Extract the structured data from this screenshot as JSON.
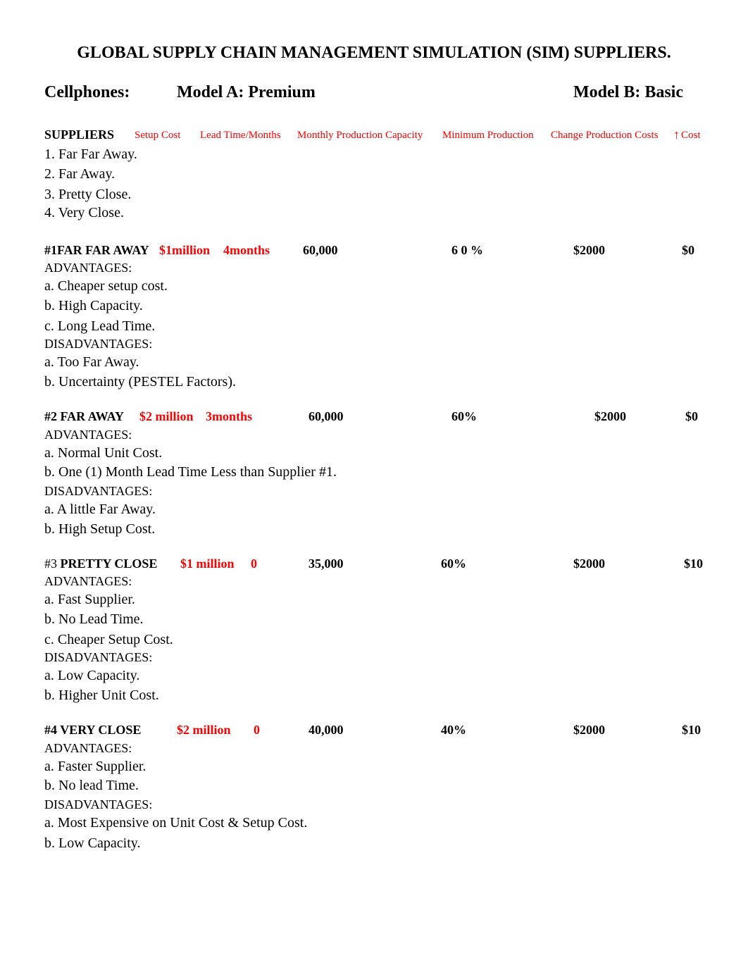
{
  "title": "GLOBAL SUPPLY CHAIN MANAGEMENT SIMULATION (SIM) SUPPLIERS.",
  "product": {
    "label": "Cellphones:",
    "model_a": "Model A:  Premium",
    "model_b": "Model B:  Basic"
  },
  "header": {
    "suppliers": "SUPPLIERS",
    "columns": [
      "Setup Cost",
      "Lead Time/Months",
      "Monthly Production Capacity",
      "Minimum Production",
      "Change Production Costs",
      "Cost"
    ],
    "up_arrow_icon": "↑"
  },
  "supplier_list": [
    "1.  Far Far Away.",
    "2.  Far Away.",
    "3.  Pretty Close.",
    "4.  Very Close."
  ],
  "suppliers": [
    {
      "number": "#1",
      "name": "FAR FAR AWAY",
      "setup_cost": "$1million",
      "lead_time": "4months",
      "capacity": "60,000",
      "min_production": "6 0 %",
      "change_cost": "$2000",
      "cost_increase": "$0",
      "advantages_label": "ADVANTAGES:",
      "advantages": [
        "a. Cheaper setup cost.",
        "b. High Capacity.",
        "c. Long Lead Time."
      ],
      "disadvantages_label": "DISADVANTAGES:",
      "disadvantages": [
        "a. Too Far Away.",
        "b. Uncertainty (PESTEL Factors)."
      ]
    },
    {
      "number": "#2",
      "name": "FAR AWAY",
      "setup_cost": "$2 million",
      "lead_time": "3months",
      "capacity": "60,000",
      "min_production": "60%",
      "change_cost": "$2000",
      "cost_increase": "$0",
      "advantages_label": "ADVANTAGES:",
      "advantages": [
        "a. Normal Unit Cost.",
        "b. One (1) Month Lead Time Less than Supplier #1."
      ],
      "disadvantages_label": "DISADVANTAGES:",
      "disadvantages": [
        "a. A little Far Away.",
        "b. High Setup Cost."
      ]
    },
    {
      "number": "#3",
      "name": "PRETTY CLOSE",
      "setup_cost": "$1 million",
      "lead_time": "0",
      "capacity": "35,000",
      "min_production": "60%",
      "change_cost": "$2000",
      "cost_increase": "$10",
      "advantages_label": "ADVANTAGES:",
      "advantages": [
        "a. Fast Supplier.",
        "b. No Lead Time.",
        "c. Cheaper Setup Cost."
      ],
      "disadvantages_label": "DISADVANTAGES:",
      "disadvantages": [
        "a. Low Capacity.",
        "b. Higher Unit Cost."
      ]
    },
    {
      "number": "#4",
      "name": "VERY CLOSE",
      "setup_cost": "$2 million",
      "lead_time": "0",
      "capacity": "40,000",
      "min_production": "40%",
      "change_cost": "$2000",
      "cost_increase": "$10",
      "advantages_label": "ADVANTAGES:",
      "advantages": [
        "a. Faster Supplier.",
        "b. No lead Time."
      ],
      "disadvantages_label": "DISADVANTAGES:",
      "disadvantages": [
        "a. Most Expensive on Unit Cost & Setup Cost.",
        "b. Low Capacity."
      ]
    }
  ]
}
